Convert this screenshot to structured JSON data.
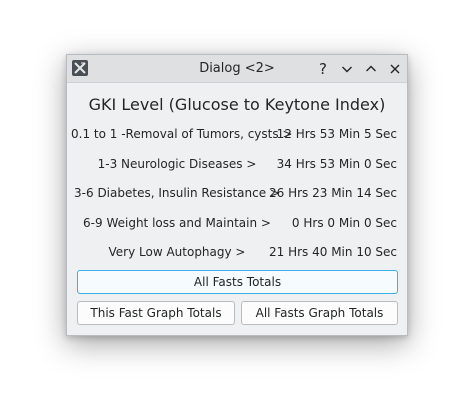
{
  "window": {
    "title": "Dialog <2>"
  },
  "titlebar_buttons": {
    "help": "?",
    "minimize": "chevron-down",
    "maximize": "chevron-up",
    "close": "close"
  },
  "heading": "GKI Level (Glucose to Keytone Index)",
  "rows": [
    {
      "label": "0.1 to 1 -Removal of Tumors, cysts >",
      "value": "12 Hrs 53 Min 5 Sec"
    },
    {
      "label": "1-3 Neurologic Diseases >",
      "value": "34 Hrs 53 Min 0 Sec"
    },
    {
      "label": "3-6 Diabetes, Insulin Resistance >",
      "value": "26 Hrs 23 Min 14 Sec"
    },
    {
      "label": "6-9 Weight loss and Maintain >",
      "value": "0 Hrs 0 Min 0 Sec"
    },
    {
      "label": "Very Low Autophagy >",
      "value": "21 Hrs 40 Min 10 Sec"
    }
  ],
  "buttons": {
    "all_fasts_totals": "All Fasts Totals",
    "this_fast_graph_totals": "This Fast Graph Totals",
    "all_fasts_graph_totals": "All Fasts Graph Totals"
  },
  "colors": {
    "window_bg": "#eff0f1",
    "titlebar_bg": "#dee0e2",
    "text": "#232627",
    "focus_accent": "#3daee9"
  }
}
